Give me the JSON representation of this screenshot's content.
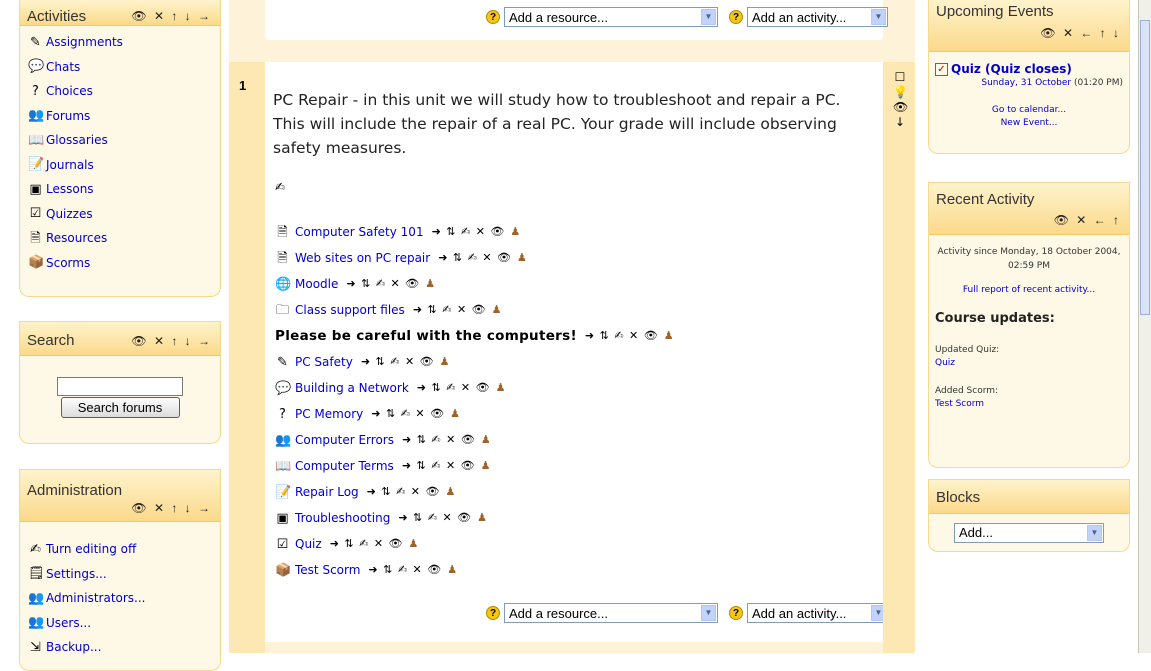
{
  "left": {
    "activities": {
      "title": "Activities",
      "controls": "👁 ✕ ↑ ↓ →",
      "items": [
        {
          "label": "Assignments",
          "icon": "assignment-icon",
          "glyph": "✎"
        },
        {
          "label": "Chats",
          "icon": "chat-icon",
          "glyph": "💬"
        },
        {
          "label": "Choices",
          "icon": "choice-icon",
          "glyph": "?"
        },
        {
          "label": "Forums",
          "icon": "forum-icon",
          "glyph": "👥"
        },
        {
          "label": "Glossaries",
          "icon": "glossary-icon",
          "glyph": "📖"
        },
        {
          "label": "Journals",
          "icon": "journal-icon",
          "glyph": "📝"
        },
        {
          "label": "Lessons",
          "icon": "lesson-icon",
          "glyph": "▣"
        },
        {
          "label": "Quizzes",
          "icon": "quiz-icon",
          "glyph": "☑"
        },
        {
          "label": "Resources",
          "icon": "resource-icon",
          "glyph": "🗎"
        },
        {
          "label": "Scorms",
          "icon": "scorm-icon",
          "glyph": "📦"
        }
      ]
    },
    "search": {
      "title": "Search",
      "controls": "👁 ✕ ↑ ↓ →",
      "button": "Search forums",
      "value": ""
    },
    "administration": {
      "title": "Administration",
      "controls": "👁 ✕ ↑ ↓ →",
      "items": [
        {
          "label": "Turn editing off",
          "icon": "edit-icon",
          "glyph": "✍"
        },
        {
          "label": "Settings...",
          "icon": "settings-icon",
          "glyph": "🗒"
        },
        {
          "label": "Administrators...",
          "icon": "admins-icon",
          "glyph": "👥"
        },
        {
          "label": "Users...",
          "icon": "users-icon",
          "glyph": "👥"
        },
        {
          "label": "Backup...",
          "icon": "backup-icon",
          "glyph": "⇲"
        }
      ]
    }
  },
  "center": {
    "top_bar": {
      "resource_select": "Add a resource...",
      "activity_select": "Add an activity..."
    },
    "section": {
      "number": "1",
      "summary": "PC Repair - in this unit we will study how to troubleshoot and repair a PC. This will include the repair of a real PC. Your grade will include observing safety measures.",
      "edit_glyph": "✍",
      "side_controls": [
        "☐",
        "💡",
        "👁",
        "↓"
      ],
      "item_controls": "➜ ⇅ ✍ ✕ 👁",
      "items": [
        {
          "label": "Computer Safety 101",
          "icon": "resource-icon",
          "glyph": "🗎",
          "type": "link"
        },
        {
          "label": "Web sites on PC repair",
          "icon": "resource-icon",
          "glyph": "🗎",
          "type": "link"
        },
        {
          "label": "Moodle",
          "icon": "web-link-icon",
          "glyph": "🌐",
          "type": "link"
        },
        {
          "label": "Class support files",
          "icon": "folder-icon",
          "glyph": "🗀",
          "type": "link"
        },
        {
          "label": "Please be careful with the computers!",
          "icon": "",
          "glyph": "",
          "type": "label"
        },
        {
          "label": "PC Safety",
          "icon": "assignment-icon",
          "glyph": "✎",
          "type": "link"
        },
        {
          "label": "Building a Network",
          "icon": "chat-icon",
          "glyph": "💬",
          "type": "link"
        },
        {
          "label": "PC Memory",
          "icon": "choice-icon",
          "glyph": "?",
          "type": "link"
        },
        {
          "label": "Computer Errors",
          "icon": "forum-icon",
          "glyph": "👥",
          "type": "link"
        },
        {
          "label": "Computer Terms",
          "icon": "glossary-icon",
          "glyph": "📖",
          "type": "link"
        },
        {
          "label": "Repair Log",
          "icon": "journal-icon",
          "glyph": "📝",
          "type": "link"
        },
        {
          "label": "Troubleshooting",
          "icon": "lesson-icon",
          "glyph": "▣",
          "type": "link"
        },
        {
          "label": "Quiz",
          "icon": "quiz-icon",
          "glyph": "☑",
          "type": "link"
        },
        {
          "label": "Test Scorm",
          "icon": "scorm-icon",
          "glyph": "📦",
          "type": "link"
        }
      ],
      "bottom_bar": {
        "resource_select": "Add a resource...",
        "activity_select": "Add an activity..."
      }
    }
  },
  "right": {
    "upcoming": {
      "title": "Upcoming Events",
      "controls": "👁 ✕ ← ↑ ↓",
      "event_title": "Quiz (Quiz closes)",
      "event_date": "Sunday, 31 October",
      "event_time": "(01:20 PM)",
      "go_calendar": "Go to calendar...",
      "new_event": "New Event..."
    },
    "recent": {
      "title": "Recent Activity",
      "controls": "👁 ✕ ← ↑",
      "since": "Activity since Monday, 18 October 2004, 02:59 PM",
      "full_report": "Full report of recent activity...",
      "updates_heading": "Course updates:",
      "updated_label": "Updated Quiz:",
      "updated_link": "Quiz",
      "added_label": "Added Scorm:",
      "added_link": "Test Scorm"
    },
    "blocks": {
      "title": "Blocks",
      "select": "Add..."
    }
  }
}
